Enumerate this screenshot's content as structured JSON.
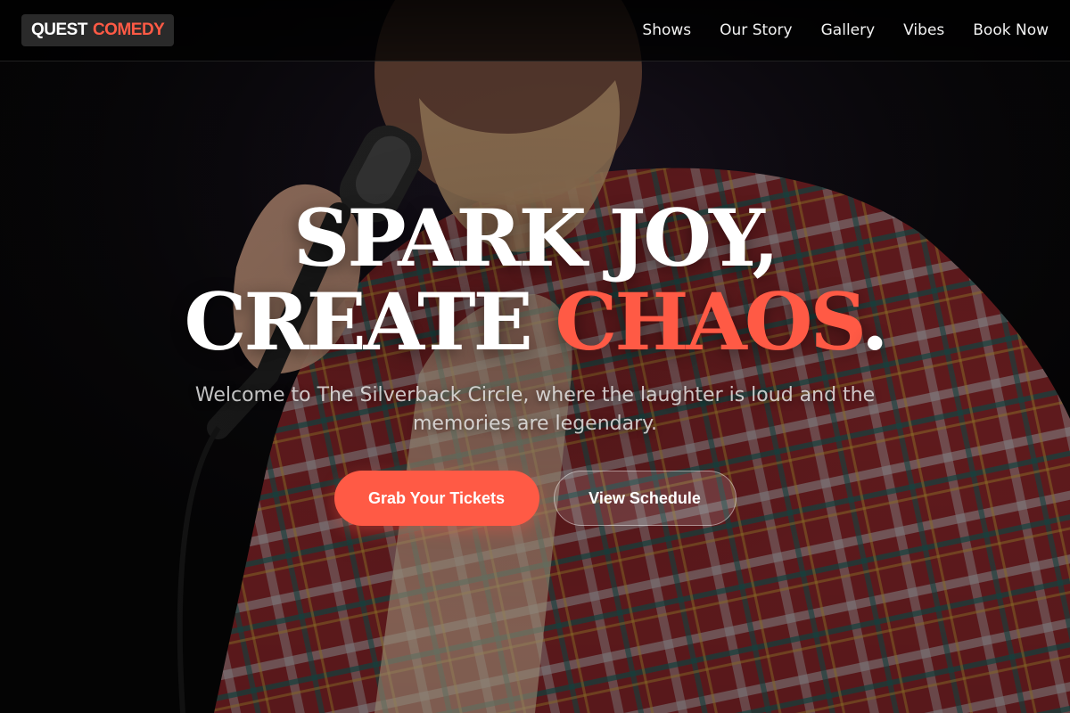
{
  "brand": {
    "part1": "QUEST",
    "part2": "COMEDY"
  },
  "nav": {
    "items": [
      {
        "label": "Shows"
      },
      {
        "label": "Our Story"
      },
      {
        "label": "Gallery"
      },
      {
        "label": "Vibes"
      },
      {
        "label": "Book Now"
      }
    ]
  },
  "hero": {
    "headline_line1": "SPARK JOY,",
    "headline_line2_main": "CREATE ",
    "headline_line2_accent": "CHAOS",
    "headline_line2_end": ".",
    "subtitle": "Welcome to The Silverback Circle, where the laughter is loud and the memories are legendary.",
    "primary_cta": "Grab Your Tickets",
    "secondary_cta": "View Schedule"
  },
  "colors": {
    "accent": "#ff5a45",
    "header_bg": "#000000",
    "text": "#ffffff"
  },
  "icons": {
    "background": "comedian-microphone-photo"
  }
}
